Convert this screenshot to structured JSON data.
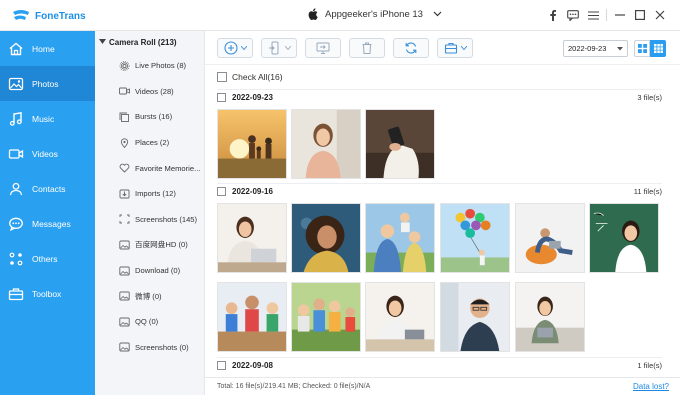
{
  "app": {
    "name": "FoneTrans",
    "accent": "#2aa0f0"
  },
  "device": {
    "name": "Appgeeker's iPhone 13",
    "icon": "apple-icon"
  },
  "window_controls": [
    "facebook-icon",
    "feedback-icon",
    "menu-icon",
    "minimize-icon",
    "maximize-icon",
    "close-icon"
  ],
  "sidebar": {
    "items": [
      {
        "label": "Home",
        "icon": "home-icon",
        "active": false
      },
      {
        "label": "Photos",
        "icon": "photos-icon",
        "active": true
      },
      {
        "label": "Music",
        "icon": "music-icon",
        "active": false
      },
      {
        "label": "Videos",
        "icon": "videos-icon",
        "active": false
      },
      {
        "label": "Contacts",
        "icon": "contacts-icon",
        "active": false
      },
      {
        "label": "Messages",
        "icon": "messages-icon",
        "active": false
      },
      {
        "label": "Others",
        "icon": "others-icon",
        "active": false
      },
      {
        "label": "Toolbox",
        "icon": "toolbox-icon",
        "active": false
      }
    ]
  },
  "folders": {
    "root": "Camera Roll (213)",
    "items": [
      {
        "label": "Live Photos (8)",
        "icon": "live-photos-icon"
      },
      {
        "label": "Videos (28)",
        "icon": "video-icon"
      },
      {
        "label": "Bursts (16)",
        "icon": "bursts-icon"
      },
      {
        "label": "Places (2)",
        "icon": "places-icon"
      },
      {
        "label": "Favorite Memorie...",
        "icon": "heart-icon"
      },
      {
        "label": "Imports (12)",
        "icon": "imports-icon"
      },
      {
        "label": "Screenshots (145)",
        "icon": "screenshots-icon"
      },
      {
        "label": "百度网盘HD (0)",
        "icon": "album-icon"
      },
      {
        "label": "Download (0)",
        "icon": "album-icon"
      },
      {
        "label": "微博 (0)",
        "icon": "album-icon"
      },
      {
        "label": "QQ (0)",
        "icon": "album-icon"
      },
      {
        "label": "Screenshots (0)",
        "icon": "album-icon"
      }
    ]
  },
  "toolbar": {
    "buttons": [
      "add-icon",
      "export-to-device-icon",
      "export-to-pc-icon",
      "delete-icon",
      "refresh-icon",
      "toolbox-icon"
    ],
    "date_filter": "2022-09-23",
    "view_modes": [
      "grid-view-icon",
      "list-view-icon"
    ]
  },
  "content": {
    "check_all": "Check All(16)",
    "groups": [
      {
        "date": "2022-09-23",
        "count": "3 file(s)",
        "photo_count": 3
      },
      {
        "date": "2022-09-16",
        "count": "11 file(s)",
        "photo_count": 11
      },
      {
        "date": "2022-09-08",
        "count": "1 file(s)",
        "photo_count": 0
      }
    ]
  },
  "status": {
    "summary": "Total: 16 file(s)/219.41 MB; Checked: 0 file(s)/N/A",
    "data_lost": "Data lost?"
  }
}
